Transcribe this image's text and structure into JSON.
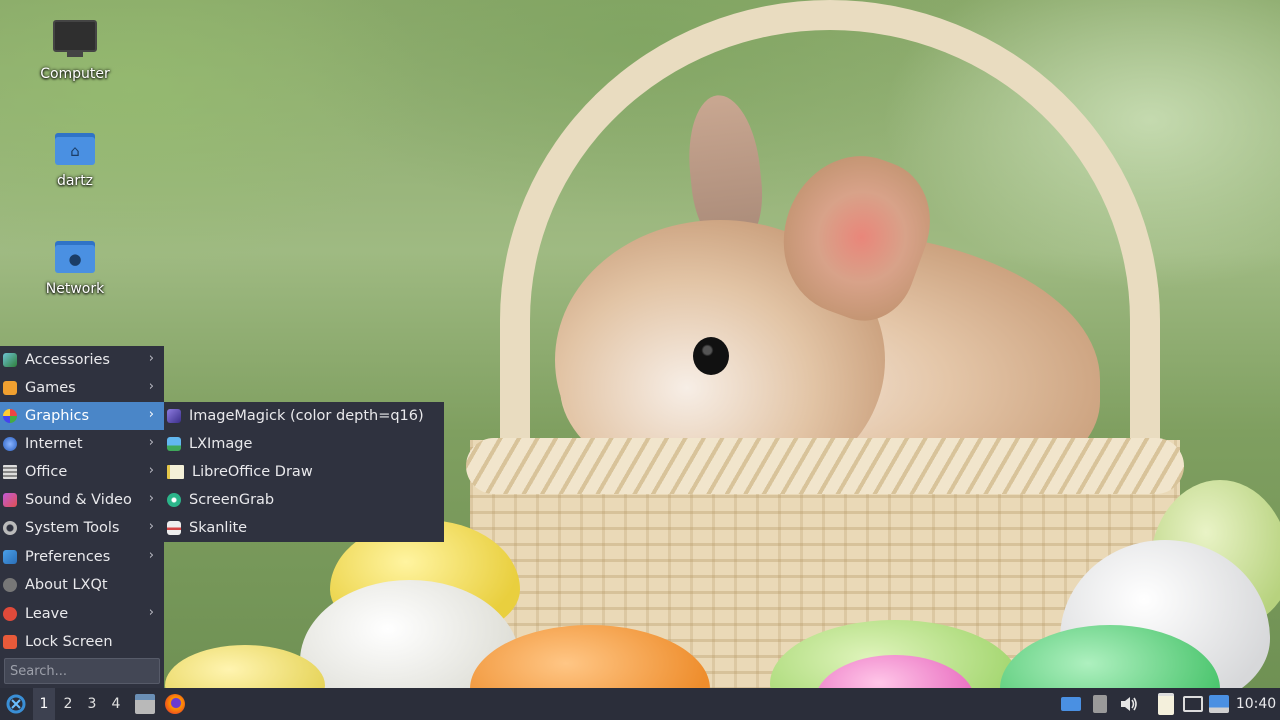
{
  "desktop": {
    "icons": [
      {
        "label": "Computer",
        "icon": "computer-icon"
      },
      {
        "label": "dartz",
        "icon": "home-folder-icon"
      },
      {
        "label": "Network",
        "icon": "network-folder-icon"
      }
    ]
  },
  "menu": {
    "items": [
      {
        "label": "Accessories",
        "icon": "accessories-icon",
        "submenu": true
      },
      {
        "label": "Games",
        "icon": "games-icon",
        "submenu": true
      },
      {
        "label": "Graphics",
        "icon": "graphics-icon",
        "submenu": true,
        "active": true
      },
      {
        "label": "Internet",
        "icon": "internet-icon",
        "submenu": true
      },
      {
        "label": "Office",
        "icon": "office-icon",
        "submenu": true
      },
      {
        "label": "Sound & Video",
        "icon": "sound-video-icon",
        "submenu": true
      },
      {
        "label": "System Tools",
        "icon": "system-tools-icon",
        "submenu": true
      },
      {
        "label": "Preferences",
        "icon": "preferences-icon",
        "submenu": true
      },
      {
        "label": "About LXQt",
        "icon": "about-icon",
        "submenu": false
      },
      {
        "label": "Leave",
        "icon": "leave-icon",
        "submenu": true
      },
      {
        "label": "Lock Screen",
        "icon": "lock-icon",
        "submenu": false
      }
    ],
    "arrow": "›",
    "search_placeholder": "Search..."
  },
  "submenu": {
    "items": [
      {
        "label": "ImageMagick (color depth=q16)",
        "icon": "imagemagick-icon"
      },
      {
        "label": "LXImage",
        "icon": "lximage-icon"
      },
      {
        "label": "LibreOffice Draw",
        "icon": "libreoffice-draw-icon"
      },
      {
        "label": "ScreenGrab",
        "icon": "screengrab-icon"
      },
      {
        "label": "Skanlite",
        "icon": "skanlite-icon"
      }
    ]
  },
  "taskbar": {
    "workspaces": [
      "1",
      "2",
      "3",
      "4"
    ],
    "active_workspace": "1",
    "clock": "10:40"
  },
  "colors": {
    "menu_bg": "#2f323f",
    "menu_highlight": "#4a86c8",
    "taskbar_bg": "#2b2e3a"
  }
}
